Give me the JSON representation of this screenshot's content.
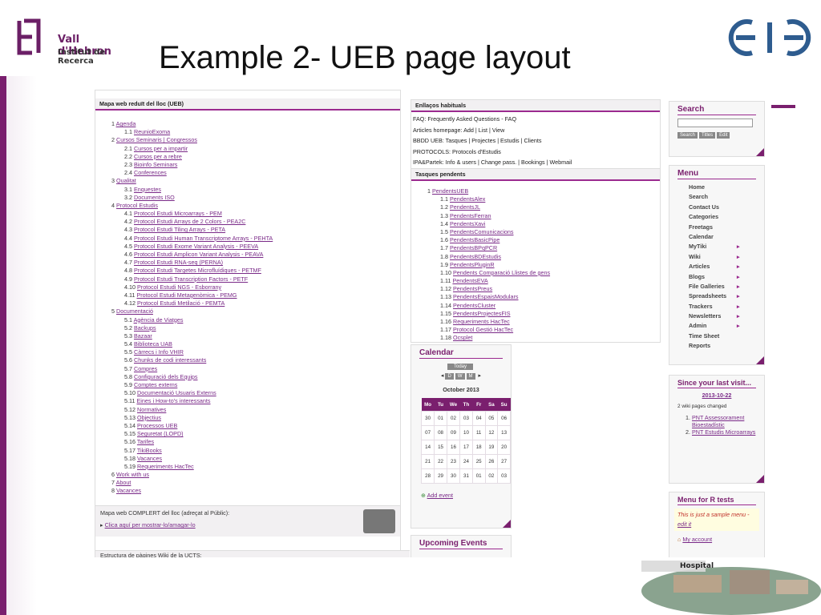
{
  "slide": {
    "title": "Example 2- UEB page layout",
    "logo_line1": "Vall d'Hebron",
    "logo_line2": "Institut de Recerca",
    "hospital_label": "Hospital"
  },
  "sitemap": {
    "header": "Mapa web reduït del lloc (UEB)",
    "rows": [
      {
        "lvl": 1,
        "num": "1",
        "text": "Agenda"
      },
      {
        "lvl": 2,
        "num": "1.1",
        "text": "ReunioExoma"
      },
      {
        "lvl": 1,
        "num": "2",
        "text": "Cursos Seminaris | Congressos"
      },
      {
        "lvl": 2,
        "num": "2.1",
        "text": "Cursos per a impartir"
      },
      {
        "lvl": 2,
        "num": "2.2",
        "text": "Cursos per a rebre"
      },
      {
        "lvl": 2,
        "num": "2.3",
        "text": "Bioinfo Seminars"
      },
      {
        "lvl": 2,
        "num": "2.4",
        "text": "Conferences"
      },
      {
        "lvl": 1,
        "num": "3",
        "text": "Qualitat"
      },
      {
        "lvl": 2,
        "num": "3.1",
        "text": "Enquestes"
      },
      {
        "lvl": 2,
        "num": "3.2",
        "text": "Documents ISO"
      },
      {
        "lvl": 1,
        "num": "4",
        "text": "Protocol Estudis"
      },
      {
        "lvl": 2,
        "num": "4.1",
        "text": "Protocol Estudi Microarrays - PEM"
      },
      {
        "lvl": 2,
        "num": "4.2",
        "text": "Protocol Estudi Arrays de 2 Colors - PEA2C"
      },
      {
        "lvl": 2,
        "num": "4.3",
        "text": "Protocol Estudi Tiling Arrays - PETA"
      },
      {
        "lvl": 2,
        "num": "4.4",
        "text": "Protocol Estudi Human Transcriptome Arrays - PEHTA"
      },
      {
        "lvl": 2,
        "num": "4.5",
        "text": "Protocol Estudi Exome Variant Analysis - PEEVA"
      },
      {
        "lvl": 2,
        "num": "4.6",
        "text": "Protocol Estudi Amplicon Variant Analysis - PEAVA"
      },
      {
        "lvl": 2,
        "num": "4.7",
        "text": "Protocol Estudi RNA-seq (PERNA)"
      },
      {
        "lvl": 2,
        "num": "4.8",
        "text": "Protocol Estudi Targetes Microfluídiques - PETMF"
      },
      {
        "lvl": 2,
        "num": "4.9",
        "text": "Protocol Estudi Transcription Factors - PETF"
      },
      {
        "lvl": 2,
        "num": "4.10",
        "text": "Protocol Estudi NGS - Esborrany"
      },
      {
        "lvl": 2,
        "num": "4.11",
        "text": "Protocol Estudi Metagenòmica - PEMG"
      },
      {
        "lvl": 2,
        "num": "4.12",
        "text": "Protocol Estudi Metilació - PEMTA"
      },
      {
        "lvl": 1,
        "num": "5",
        "text": "Documentació"
      },
      {
        "lvl": 2,
        "num": "5.1",
        "text": "Agència de Viatges"
      },
      {
        "lvl": 2,
        "num": "5.2",
        "text": "Backups"
      },
      {
        "lvl": 2,
        "num": "5.3",
        "text": "Bazaar"
      },
      {
        "lvl": 2,
        "num": "5.4",
        "text": "Biblioteca UAB"
      },
      {
        "lvl": 2,
        "num": "5.5",
        "text": "Càrrecs i Info VHIR"
      },
      {
        "lvl": 2,
        "num": "5.6",
        "text": "Chunks de codi interessants"
      },
      {
        "lvl": 2,
        "num": "5.7",
        "text": "Compres"
      },
      {
        "lvl": 2,
        "num": "5.8",
        "text": "Configuració dels Equips"
      },
      {
        "lvl": 2,
        "num": "5.9",
        "text": "Comptes externs"
      },
      {
        "lvl": 2,
        "num": "5.10",
        "text": "Documentació Usuaris Externs"
      },
      {
        "lvl": 2,
        "num": "5.11",
        "text": "Eines i How-to's interessants"
      },
      {
        "lvl": 2,
        "num": "5.12",
        "text": "Normatives"
      },
      {
        "lvl": 2,
        "num": "5.13",
        "text": "Objectius"
      },
      {
        "lvl": 2,
        "num": "5.14",
        "text": "Processos UEB"
      },
      {
        "lvl": 2,
        "num": "5.15",
        "text": "Seguretat (LOPD)"
      },
      {
        "lvl": 2,
        "num": "5.16",
        "text": "Tarifes"
      },
      {
        "lvl": 2,
        "num": "5.17",
        "text": "TikiBooks"
      },
      {
        "lvl": 2,
        "num": "5.18",
        "text": "Vacances"
      },
      {
        "lvl": 2,
        "num": "5.19",
        "text": "Requeriments HacTec"
      },
      {
        "lvl": 1,
        "num": "6",
        "text": "Work with us"
      },
      {
        "lvl": 1,
        "num": "7",
        "text": "About"
      },
      {
        "lvl": 1,
        "num": "8",
        "text": "Vacances"
      }
    ],
    "complete_header": "Mapa web COMPLERT del lloc (adreçat al Públic):",
    "complete_link": "Clica aquí per mostrar-lo/amagar-lo",
    "structure_header": "Estructura de pàgines Wiki de la UCTS:"
  },
  "links": {
    "header": "Enllaços habituals",
    "lines": [
      "FAQ: Frequently Asked Questions - FAQ",
      "Articles homepage: Add | List | View",
      "BBDD UEB: Tasques | Projectes | Estudis | Clients",
      "PROTOCOLS: Protocols d'Estudis",
      "IPA&Partek: Info & users | Change pass. | Bookings | Webmail"
    ]
  },
  "tasks": {
    "header": "Tasques pendents",
    "rows": [
      {
        "lvl": 1,
        "num": "1",
        "text": "PendentsUEB"
      },
      {
        "lvl": 2,
        "num": "1.1",
        "text": "PendentsAlex"
      },
      {
        "lvl": 2,
        "num": "1.2",
        "text": "PendentsJL"
      },
      {
        "lvl": 2,
        "num": "1.3",
        "text": "PendentsFerran"
      },
      {
        "lvl": 2,
        "num": "1.4",
        "text": "PendentsXavi"
      },
      {
        "lvl": 2,
        "num": "1.5",
        "text": "PendentsComunicacions"
      },
      {
        "lvl": 2,
        "num": "1.6",
        "text": "PendentsBasicPipe"
      },
      {
        "lvl": 2,
        "num": "1.7",
        "text": "PendentsBPqPCR"
      },
      {
        "lvl": 2,
        "num": "1.8",
        "text": "PendentsBDEstudis"
      },
      {
        "lvl": 2,
        "num": "1.9",
        "text": "PendentsPluginR"
      },
      {
        "lvl": 2,
        "num": "1.10",
        "text": "Pendents Comparació Llistes de gens"
      },
      {
        "lvl": 2,
        "num": "1.11",
        "text": "PendentsEVA"
      },
      {
        "lvl": 2,
        "num": "1.12",
        "text": "PendentsPreus"
      },
      {
        "lvl": 2,
        "num": "1.13",
        "text": "PendentsEspaisModulars"
      },
      {
        "lvl": 2,
        "num": "1.14",
        "text": "PendentsCluster"
      },
      {
        "lvl": 2,
        "num": "1.15",
        "text": "PendentsProjectesFIS"
      },
      {
        "lvl": 2,
        "num": "1.16",
        "text": "Requeriments HacTec"
      },
      {
        "lvl": 2,
        "num": "1.17",
        "text": "Protocol Gestió HacTec"
      },
      {
        "lvl": 2,
        "num": "1.18",
        "text": "Ocsplet"
      }
    ]
  },
  "calendar": {
    "title": "Calendar",
    "today": "Today",
    "views": [
      "D",
      "W",
      "M"
    ],
    "month": "October 2013",
    "days": [
      "Mo",
      "Tu",
      "We",
      "Th",
      "Fr",
      "Sa",
      "Su"
    ],
    "weeks": [
      [
        "30",
        "01",
        "02",
        "03",
        "04",
        "05",
        "06"
      ],
      [
        "07",
        "08",
        "09",
        "10",
        "11",
        "12",
        "13"
      ],
      [
        "14",
        "15",
        "16",
        "17",
        "18",
        "19",
        "20"
      ],
      [
        "21",
        "22",
        "23",
        "24",
        "25",
        "26",
        "27"
      ],
      [
        "28",
        "29",
        "30",
        "31",
        "01",
        "02",
        "03"
      ]
    ],
    "add_event": "Add event",
    "upcoming": "Upcoming Events"
  },
  "search": {
    "title": "Search",
    "buttons": [
      "Search",
      "Titles",
      "Edit"
    ]
  },
  "menu": {
    "title": "Menu",
    "items": [
      {
        "label": "Home",
        "sub": false
      },
      {
        "label": "Search",
        "sub": false
      },
      {
        "label": "Contact Us",
        "sub": false
      },
      {
        "label": "Categories",
        "sub": false
      },
      {
        "label": "Freetags",
        "sub": false
      },
      {
        "label": "Calendar",
        "sub": false
      },
      {
        "label": "MyTiki",
        "sub": true
      },
      {
        "label": "Wiki",
        "sub": true
      },
      {
        "label": "Articles",
        "sub": true
      },
      {
        "label": "Blogs",
        "sub": true
      },
      {
        "label": "File Galleries",
        "sub": true
      },
      {
        "label": "Spreadsheets",
        "sub": true
      },
      {
        "label": "Trackers",
        "sub": true
      },
      {
        "label": "Newsletters",
        "sub": true
      },
      {
        "label": "Admin",
        "sub": true
      },
      {
        "label": "Time Sheet",
        "sub": false
      },
      {
        "label": "Reports",
        "sub": false
      }
    ]
  },
  "since": {
    "title": "Since your last visit...",
    "date": "2013-10-22",
    "changed": "2 wiki pages changed",
    "items": [
      "PNT Assessorament Bioestadístic",
      "PNT Estudis Microarrays"
    ]
  },
  "rmenu": {
    "title": "Menu for R tests",
    "note": "This is just a sample menu -",
    "edit": "edit it",
    "account": "My account"
  },
  "colors": {
    "accent": "#7a1f6e",
    "link": "#7a2a88"
  }
}
